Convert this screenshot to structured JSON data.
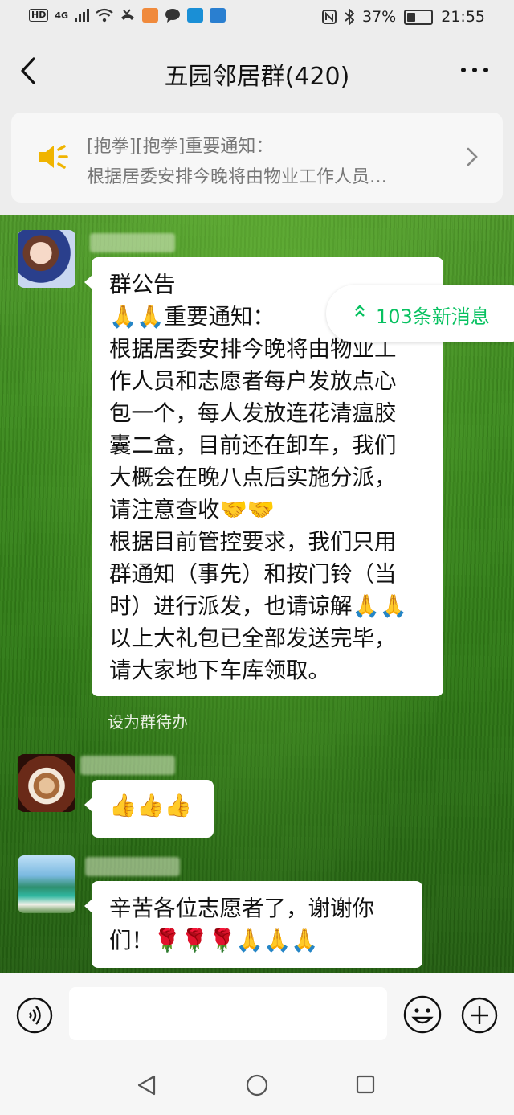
{
  "status_bar": {
    "hd": "HD",
    "network": "4G",
    "battery": "37%",
    "battery_level": 0.37,
    "time": "21:55"
  },
  "header": {
    "title": "五园邻居群(420)"
  },
  "pinned_notice": {
    "line1": "[抱拳][抱拳]重要通知：",
    "line2": "根据居委安排今晚将由物业工作人员…"
  },
  "new_messages": {
    "label": "103条新消息"
  },
  "messages": [
    {
      "lines": [
        "群公告",
        "🙏🙏重要通知：",
        "根据居委安排今晚将由物业工",
        "作人员和志愿者每户发放点心",
        "包一个，每人发放连花清瘟胶",
        "囊二盒，目前还在卸车，我们",
        "大概会在晚八点后实施分派，",
        "请注意查收🤝🤝",
        "根据目前管控要求，我们只用",
        "群通知（事先）和按门铃（当",
        "时）进行派发，也请谅解🙏🙏",
        "以上大礼包已全部发送完毕，",
        "请大家地下车库领取。"
      ],
      "action": "设为群待办"
    },
    {
      "emoji": "👍👍👍"
    },
    {
      "lines": [
        "辛苦各位志愿者了，谢谢你",
        "们！🌹🌹🌹🙏🙏🙏"
      ]
    }
  ],
  "icons": {
    "back": "chevron-left-icon",
    "more": "more-dots-icon",
    "speaker": "speaker-icon",
    "voice": "voice-icon",
    "emoji": "emoji-icon",
    "plus": "plus-icon"
  },
  "colors": {
    "accent_green": "#07c160",
    "speaker_yellow": "#f0b400"
  }
}
